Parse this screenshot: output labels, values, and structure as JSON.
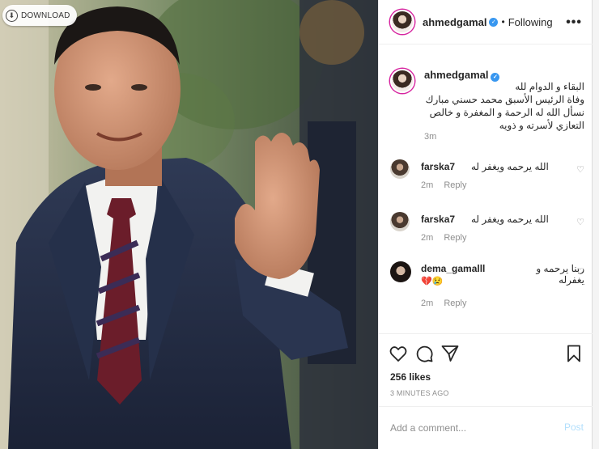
{
  "download_label": "DOWNLOAD",
  "header": {
    "username": "ahmedgamal",
    "separator": "•",
    "follow_status": "Following",
    "more": "•••"
  },
  "caption": {
    "username": "ahmedgamal",
    "lines": [
      "البقاء و الدوام لله",
      "وفاة الرئيس الأسبق محمد حسني مبارك",
      "نسأل الله له الرحمة و المغفرة و خالص",
      "التعازي لأسرته و ذويه"
    ],
    "time": "3m"
  },
  "comments": [
    {
      "username": "farska7",
      "text": "الله يرحمه ويغفر له",
      "emoji": "",
      "time": "2m",
      "reply": "Reply"
    },
    {
      "username": "farska7",
      "text": "الله يرحمه ويغفر له",
      "emoji": "",
      "time": "2m",
      "reply": "Reply"
    },
    {
      "username": "dema_gamalll",
      "text": "ربنا يرحمه و يغفرله",
      "emoji": "💔😢",
      "time": "2m",
      "reply": "Reply"
    }
  ],
  "likes": "256 likes",
  "time_ago": "3 MINUTES AGO",
  "add_comment": {
    "placeholder": "Add a comment...",
    "post_label": "Post"
  },
  "colors": {
    "accent": "#3897f0",
    "post_disabled": "#b2dffc",
    "muted": "#8e8e8e"
  },
  "icons": [
    "download-icon",
    "verified-icon",
    "more-icon",
    "heart-icon",
    "comment-icon",
    "share-icon",
    "bookmark-icon"
  ]
}
